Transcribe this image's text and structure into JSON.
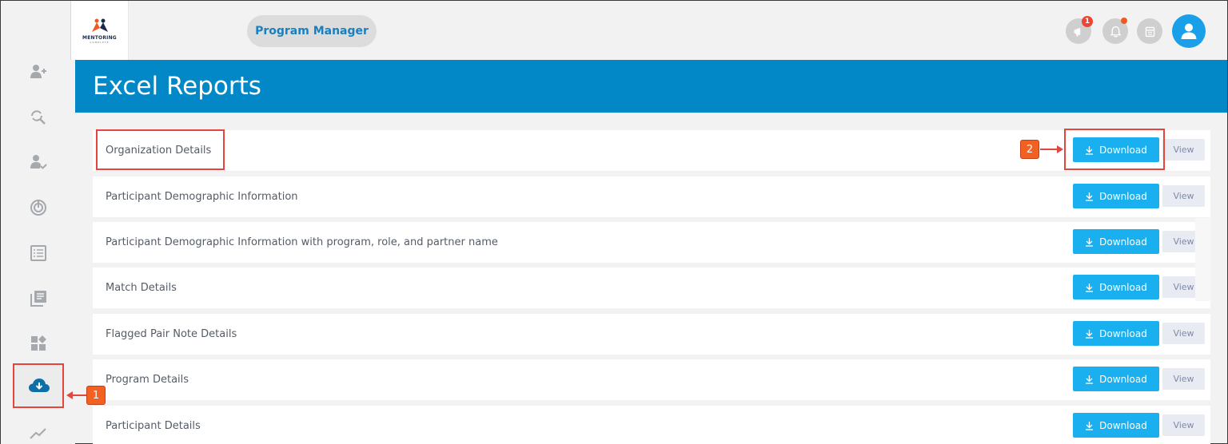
{
  "header": {
    "logo_text": "MENTORING",
    "logo_sub": "COMPLETE",
    "role_label": "Program Manager",
    "announcement_badge": "1",
    "icons": [
      "megaphone-icon",
      "bell-icon",
      "calendar-icon",
      "user-avatar-icon"
    ]
  },
  "sidebar": {
    "icons": [
      "add-user-icon",
      "search-refresh-icon",
      "user-check-icon",
      "target-icon",
      "list-icon",
      "library-icon",
      "widgets-icon",
      "cloud-download-icon",
      "trend-icon"
    ],
    "active": "cloud-download-icon"
  },
  "page": {
    "title": "Excel Reports"
  },
  "reports": [
    {
      "name": "Organization Details",
      "download_label": "Download",
      "view_label": "View"
    },
    {
      "name": "Participant Demographic Information",
      "download_label": "Download",
      "view_label": "View"
    },
    {
      "name": "Participant Demographic Information with program, role, and partner name",
      "download_label": "Download",
      "view_label": "View"
    },
    {
      "name": "Match Details",
      "download_label": "Download",
      "view_label": "View"
    },
    {
      "name": "Flagged Pair Note Details",
      "download_label": "Download",
      "view_label": "View"
    },
    {
      "name": "Program Details",
      "download_label": "Download",
      "view_label": "View"
    },
    {
      "name": "Participant Details",
      "download_label": "Download",
      "view_label": "View"
    }
  ],
  "annotations": {
    "step1": "1",
    "step2": "2"
  },
  "colors": {
    "banner": "#0288c7",
    "download": "#1ab0ef",
    "accent_red": "#e5443f",
    "callout": "#f26022"
  }
}
